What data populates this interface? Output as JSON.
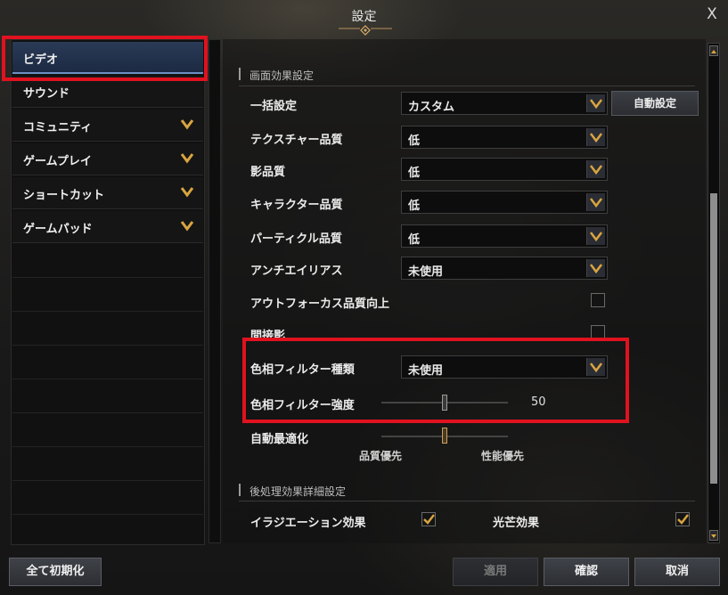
{
  "window": {
    "title": "設定",
    "close_label": "X"
  },
  "sidebar": {
    "items": [
      {
        "label": "ビデオ",
        "active": true,
        "expandable": false
      },
      {
        "label": "サウンド",
        "active": false,
        "expandable": false
      },
      {
        "label": "コミュニティ",
        "active": false,
        "expandable": true
      },
      {
        "label": "ゲームプレイ",
        "active": false,
        "expandable": true
      },
      {
        "label": "ショートカット",
        "active": false,
        "expandable": true
      },
      {
        "label": "ゲームパッド",
        "active": false,
        "expandable": true
      }
    ]
  },
  "screen_effects": {
    "header": "画面効果設定",
    "bulk": {
      "label": "一括設定",
      "value": "カスタム",
      "auto_button": "自動設定"
    },
    "texture": {
      "label": "テクスチャー品質",
      "value": "低"
    },
    "shadow": {
      "label": "影品質",
      "value": "低"
    },
    "character": {
      "label": "キャラクター品質",
      "value": "低"
    },
    "particle": {
      "label": "パーティクル品質",
      "value": "低"
    },
    "antialias": {
      "label": "アンチエイリアス",
      "value": "未使用"
    },
    "outfocus": {
      "label": "アウトフォーカス品質向上",
      "checked": false
    },
    "indirect_shadow": {
      "label": "間接影",
      "checked": false
    },
    "hue_filter_type": {
      "label": "色相フィルター種類",
      "value": "未使用"
    },
    "hue_filter_strength": {
      "label": "色相フィルター強度",
      "value": "50",
      "fraction": 0.5
    },
    "auto_optimize": {
      "label": "自動最適化",
      "left_caption": "品質優先",
      "right_caption": "性能優先",
      "fraction": 0.5
    }
  },
  "post_processing": {
    "header": "後処理効果詳細設定",
    "irradiation": {
      "label": "イラジエーション効果",
      "checked": true
    },
    "glare": {
      "label": "光芒効果",
      "checked": true
    }
  },
  "footer": {
    "reset_all": "全て初期化",
    "apply": "適用",
    "confirm": "確認",
    "cancel": "取消"
  },
  "colors": {
    "highlight": "#e0121f",
    "accent_gold": "#d9a441",
    "active_tab": "#2a3b57"
  }
}
